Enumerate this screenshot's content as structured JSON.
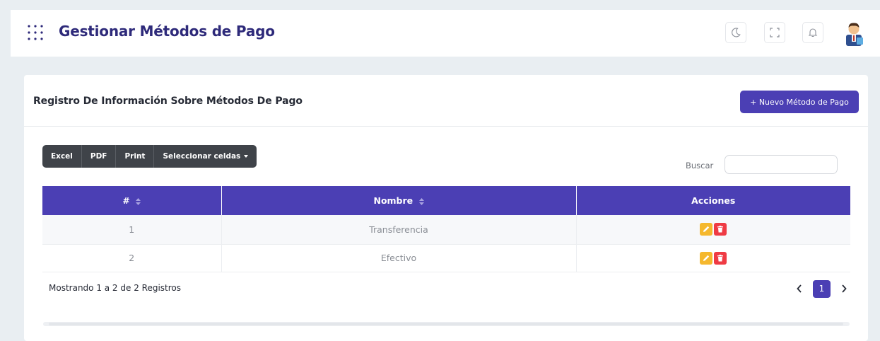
{
  "header": {
    "title": "Gestionar Métodos de Pago",
    "icons": [
      "apps-menu-icon",
      "moon-icon",
      "fullscreen-icon",
      "bell-icon",
      "avatar"
    ]
  },
  "card": {
    "title": "Registro De Información Sobre Métodos De Pago",
    "new_button_label": "+ Nuevo Método de Pago"
  },
  "toolbar": {
    "buttons": [
      "Excel",
      "PDF",
      "Print",
      "Seleccionar celdas"
    ]
  },
  "search": {
    "label": "Buscar",
    "value": ""
  },
  "table": {
    "columns": [
      "#",
      "Nombre",
      "Acciones"
    ],
    "rows": [
      {
        "id": "1",
        "nombre": "Transferencia"
      },
      {
        "id": "2",
        "nombre": "Efectivo"
      }
    ]
  },
  "footer": {
    "info": "Mostrando 1 a 2 de 2 Registros",
    "current_page": "1"
  },
  "colors": {
    "primary": "#4b3fb4",
    "title": "#2e2a7a",
    "edit": "#f5b82e",
    "delete": "#ef3b44",
    "toolbar": "#3f4349"
  }
}
